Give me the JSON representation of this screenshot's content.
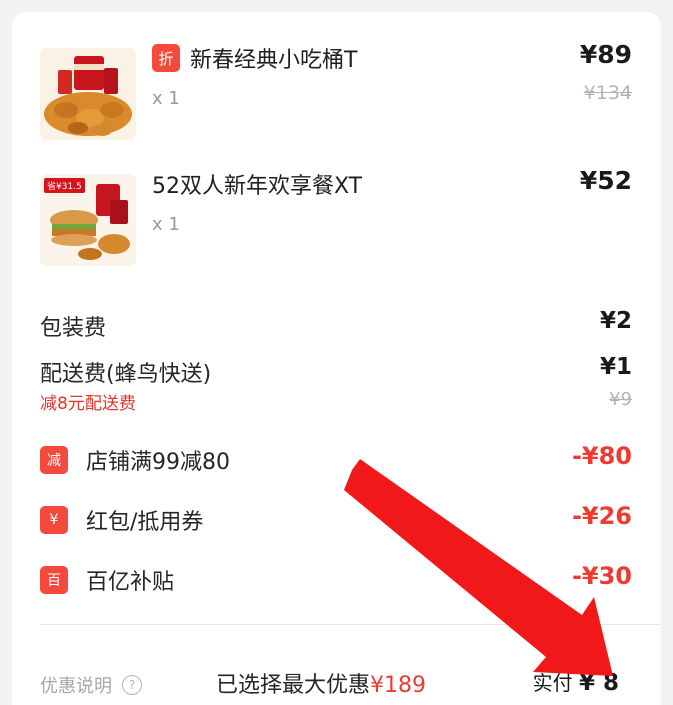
{
  "items": [
    {
      "name": "新春经典小吃桶T",
      "tag": "折",
      "qty": "x 1",
      "price": "¥89",
      "original_price": "¥134"
    },
    {
      "name": "52双人新年欢享餐XT",
      "thumb_badge": "省¥31.5",
      "qty": "x 1",
      "price": "¥52"
    }
  ],
  "fees": {
    "packaging": {
      "label": "包装费",
      "value": "¥2"
    },
    "delivery": {
      "label": "配送费(蜂鸟快送)",
      "value": "¥1",
      "sub_label": "减8元配送费",
      "original": "¥9"
    }
  },
  "discounts": [
    {
      "icon": "减",
      "label": "店铺满99减80",
      "value": "-¥80"
    },
    {
      "icon": "¥",
      "label": "红包/抵用券",
      "value": "-¥26"
    },
    {
      "icon": "百",
      "label": "百亿补贴",
      "value": "-¥30"
    }
  ],
  "footer": {
    "note": "优惠说明",
    "max_prefix": "已选择最大优惠",
    "max_amount": "¥189",
    "pay_label": "实付",
    "pay_value": "¥ 8"
  },
  "colors": {
    "accent": "#f34a3d",
    "discount_text": "#ee3b2f",
    "arrow": "#f01818"
  }
}
